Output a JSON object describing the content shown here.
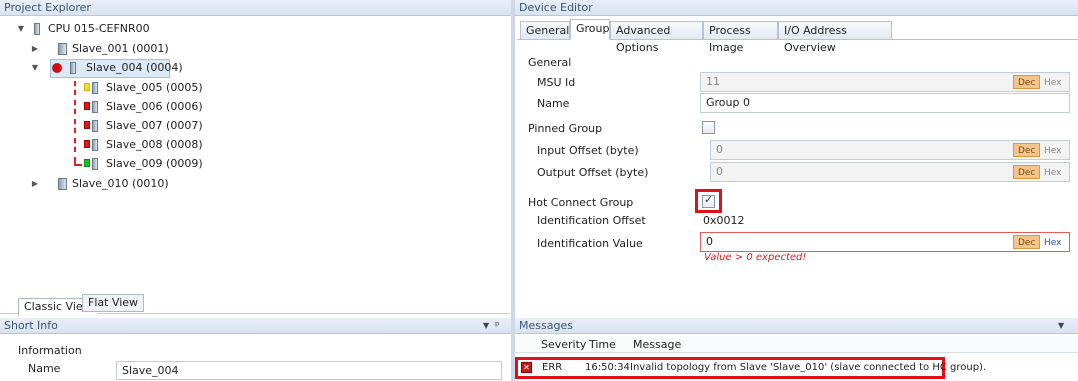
{
  "project_explorer": {
    "title": "Project Explorer",
    "root": {
      "label": "CPU 015-CEFNR00"
    },
    "items": [
      {
        "label": "Slave_001 (0001)"
      },
      {
        "label": "Slave_004 (0004)"
      },
      {
        "label": "Slave_005 (0005)"
      },
      {
        "label": "Slave_006 (0006)"
      },
      {
        "label": "Slave_007 (0007)"
      },
      {
        "label": "Slave_008 (0008)"
      },
      {
        "label": "Slave_009 (0009)"
      },
      {
        "label": "Slave_010 (0010)"
      }
    ],
    "view_tabs": {
      "classic": "Classic View",
      "flat": "Flat View"
    }
  },
  "short_info": {
    "title": "Short Info",
    "section": "Information",
    "name_label": "Name",
    "name_value": "Slave_004"
  },
  "device_editor": {
    "title": "Device Editor",
    "tabs": [
      "General",
      "Group",
      "Advanced Options",
      "Process Image",
      "I/O Address Overview"
    ],
    "active_tab": "Group",
    "section_general": "General",
    "msu_id_label": "MSU Id",
    "msu_id_value": "11",
    "name_label": "Name",
    "name_value": "Group 0",
    "pinned_group_label": "Pinned Group",
    "input_offset_label": "Input Offset (byte)",
    "input_offset_value": "0",
    "output_offset_label": "Output Offset (byte)",
    "output_offset_value": "0",
    "hot_connect_label": "Hot Connect Group",
    "hot_connect_checked": true,
    "ident_offset_label": "Identification Offset",
    "ident_offset_value": "0x0012",
    "ident_value_label": "Identification Value",
    "ident_value_value": "0",
    "ident_value_error": "Value > 0 expected!",
    "dec_label": "Dec",
    "hex_label": "Hex"
  },
  "messages": {
    "title": "Messages",
    "columns": [
      "Severity",
      "Time",
      "Message"
    ],
    "rows": [
      {
        "severity": "ERR",
        "time": "16:50:34",
        "message": "Invalid topology from Slave 'Slave_010' (slave connected to HC group)."
      }
    ]
  },
  "colors": {
    "accent_red": "#e0101a",
    "header_blue": "#3d5370",
    "dec_orange": "#f4c48c"
  },
  "icons": [
    "expand-arrow-icon",
    "collapse-arrow-icon",
    "device-icon",
    "status-chip-icon",
    "error-ball-icon",
    "pin-icon",
    "dropdown-icon",
    "error-icon"
  ]
}
